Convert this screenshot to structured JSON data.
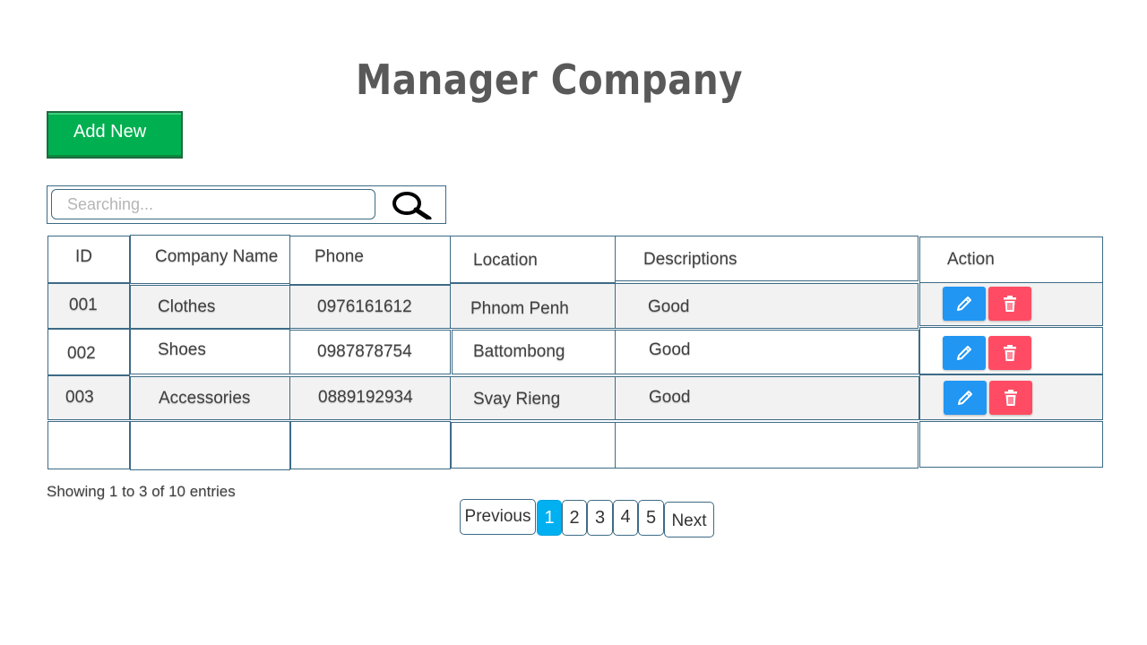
{
  "page": {
    "title": "Manager Company"
  },
  "toolbar": {
    "add_label": "Add New"
  },
  "search": {
    "placeholder": "Searching..."
  },
  "table": {
    "headers": {
      "id": "ID",
      "company": "Company Name",
      "phone": "Phone",
      "location": "Location",
      "descriptions": "Descriptions",
      "action": "Action"
    },
    "rows": [
      {
        "id": "001",
        "company": "Clothes",
        "phone": "0976161612",
        "location": "Phnom Penh",
        "descriptions": "Good"
      },
      {
        "id": "002",
        "company": "Shoes",
        "phone": "0987878754",
        "location": "Battombong",
        "descriptions": "Good"
      },
      {
        "id": "003",
        "company": "Accessories",
        "phone": "0889192934",
        "location": "Svay Rieng",
        "descriptions": "Good"
      }
    ]
  },
  "footer": {
    "entries": "Showing 1 to 3 of 10 entries"
  },
  "pagination": {
    "previous": "Previous",
    "pages": [
      "1",
      "2",
      "3",
      "4",
      "5"
    ],
    "active_page": "1",
    "next": "Next"
  },
  "icons": {
    "search": "search-icon",
    "edit": "pencil-icon",
    "delete": "trash-icon"
  },
  "colors": {
    "add_button": "#00b050",
    "edit_button": "#2196f3",
    "delete_button": "#ff4c64",
    "active_page": "#00b0f0",
    "border": "#3d6b86"
  }
}
